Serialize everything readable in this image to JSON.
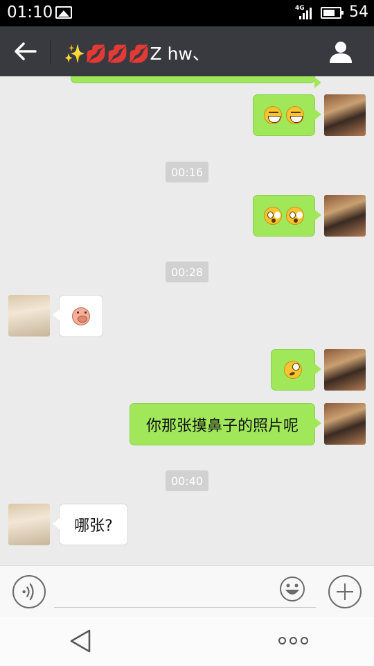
{
  "status_bar": {
    "time": "01:10",
    "network_label": "4G",
    "battery_percent": "54"
  },
  "header": {
    "back_icon": "arrow-left-icon",
    "chat_title_emojis": "✨💋💋💋",
    "chat_title_text": "Z hw、",
    "profile_icon": "person-icon"
  },
  "messages": [
    {
      "type": "outgoing",
      "content": "emoji",
      "emojis": [
        "grin",
        "grin"
      ]
    },
    {
      "type": "timestamp",
      "text": "00:16"
    },
    {
      "type": "outgoing",
      "content": "emoji",
      "emojis": [
        "shock",
        "shock"
      ]
    },
    {
      "type": "timestamp",
      "text": "00:28"
    },
    {
      "type": "incoming",
      "content": "emoji",
      "emojis": [
        "pig"
      ]
    },
    {
      "type": "outgoing",
      "content": "emoji",
      "emojis": [
        "dizzy"
      ]
    },
    {
      "type": "outgoing",
      "content": "text",
      "text": "你那张摸鼻子的照片呢"
    },
    {
      "type": "timestamp",
      "text": "00:40"
    },
    {
      "type": "incoming",
      "content": "text",
      "text": "哪张?"
    }
  ],
  "input_bar": {
    "voice_icon": "voice-icon",
    "text_value": "",
    "emoji_icon": "smiley-icon",
    "more_icon": "plus-icon"
  },
  "nav_bar": {
    "back_icon": "triangle-back-icon",
    "menu_icon": "more-dots-icon"
  },
  "colors": {
    "header_bg": "#393a3f",
    "outgoing_bubble": "#a0e75a",
    "incoming_bubble": "#ffffff",
    "chat_bg": "#ebebeb",
    "timestamp_bg": "#d1d1d1"
  }
}
